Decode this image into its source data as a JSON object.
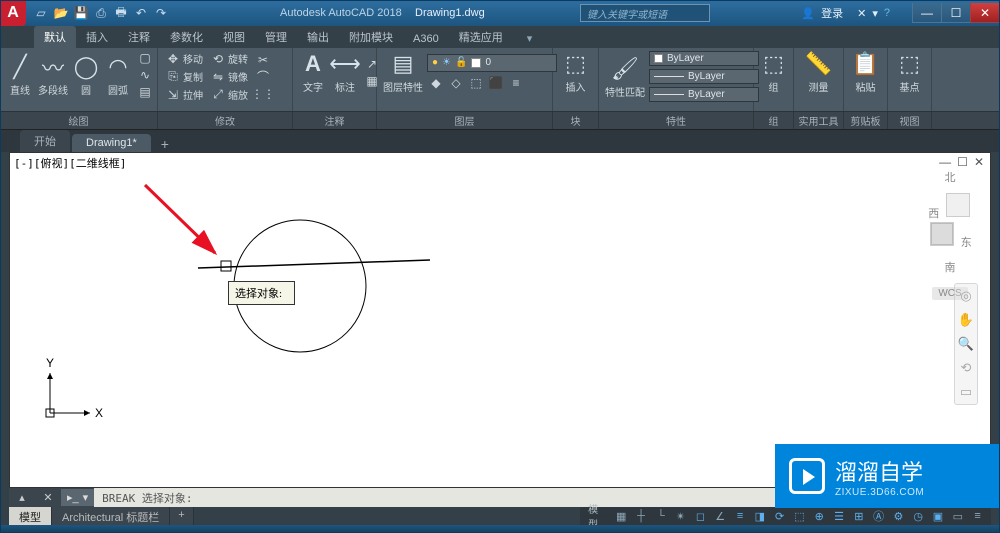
{
  "titlebar": {
    "app_title": "Autodesk AutoCAD 2018",
    "doc_title": "Drawing1.dwg",
    "search_placeholder": "键入关键字或短语",
    "user_label": "登录",
    "logo": "A"
  },
  "menus": {
    "items": [
      "默认",
      "插入",
      "注释",
      "参数化",
      "视图",
      "管理",
      "输出",
      "附加模块",
      "A360",
      "精选应用"
    ],
    "active_index": 0
  },
  "ribbon_panels": {
    "draw": {
      "name": "绘图",
      "items": [
        "直线",
        "多段线",
        "圆",
        "圆弧"
      ]
    },
    "modify": {
      "name": "修改",
      "items": [
        "移动",
        "复制",
        "拉伸",
        "旋转",
        "镜像",
        "缩放"
      ]
    },
    "annotate": {
      "name": "注释",
      "items": [
        "文字",
        "标注"
      ]
    },
    "layers": {
      "name": "图层",
      "label": "图层特性",
      "current": "0"
    },
    "block": {
      "name": "块",
      "label": "插入"
    },
    "props": {
      "name": "特性",
      "label": "特性匹配",
      "vals": [
        "ByLayer",
        "ByLayer",
        "ByLayer"
      ]
    },
    "group": {
      "name": "组",
      "label": "组"
    },
    "utils": {
      "name": "实用工具",
      "label": "测量"
    },
    "clip": {
      "name": "剪贴板",
      "label": "粘贴"
    },
    "view": {
      "name": "视图",
      "label": "基点"
    }
  },
  "doctabs": {
    "items": [
      "开始",
      "Drawing1*"
    ],
    "active_index": 1
  },
  "canvas": {
    "view_label": "[-][俯视][二维线框]",
    "tooltip": "选择对象:",
    "ucs": {
      "x": "X",
      "y": "Y"
    },
    "nav": {
      "north": "北",
      "west": "西",
      "east": "东",
      "south": "南",
      "wcs": "WCS"
    }
  },
  "command": {
    "text": "BREAK 选择对象:",
    "prompt": "▾"
  },
  "layout_tabs": {
    "items": [
      "模型",
      "Architectural 标题栏"
    ],
    "active_index": 0
  },
  "status": {
    "model": "模型"
  },
  "watermark": {
    "brand": "溜溜自学",
    "url": "ZIXUE.3D66.COM"
  }
}
